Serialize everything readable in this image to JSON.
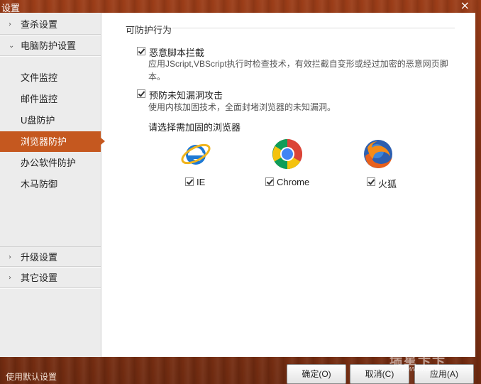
{
  "window": {
    "title": "设置",
    "close_glyph": "×"
  },
  "sidebar": {
    "groups_top": [
      {
        "label": "查杀设置",
        "icon": "chevron-right-icon",
        "glyph": "›"
      },
      {
        "label": "电脑防护设置",
        "icon": "chevron-down-icon",
        "glyph": "⌄"
      }
    ],
    "items": [
      {
        "label": "文件监控"
      },
      {
        "label": "邮件监控"
      },
      {
        "label": "U盘防护"
      },
      {
        "label": "浏览器防护"
      },
      {
        "label": "办公软件防护"
      },
      {
        "label": "木马防御"
      }
    ],
    "groups_bottom": [
      {
        "label": "升级设置",
        "icon": "chevron-right-icon",
        "glyph": "›"
      },
      {
        "label": "其它设置",
        "icon": "chevron-right-icon",
        "glyph": "›"
      }
    ]
  },
  "main": {
    "section_title": "可防护行为",
    "options": [
      {
        "label": "恶意脚本拦截",
        "checked": true,
        "desc": "应用JScript,VBScript执行时检查技术，有效拦截自变形或经过加密的恶意网页脚本。"
      },
      {
        "label": "预防未知漏洞攻击",
        "checked": true,
        "desc": "使用内核加固技术，全面封堵浏览器的未知漏洞。"
      }
    ],
    "browser_title": "请选择需加固的浏览器",
    "browsers": [
      {
        "label": "IE",
        "checked": true,
        "icon": "ie-logo-icon"
      },
      {
        "label": "Chrome",
        "checked": true,
        "icon": "chrome-logo-icon"
      },
      {
        "label": "火狐",
        "checked": true,
        "icon": "firefox-logo-icon"
      }
    ]
  },
  "footer": {
    "default_link": "使用默认设置",
    "ok_label": "确定(O)",
    "cancel_label": "取消(C)",
    "apply_label": "应用(A)",
    "watermark": "瑞星卡卡",
    "watermark_url": "www.ikaka.com"
  },
  "colors": {
    "accent": "#c5581f",
    "wood": "#8a3515"
  }
}
